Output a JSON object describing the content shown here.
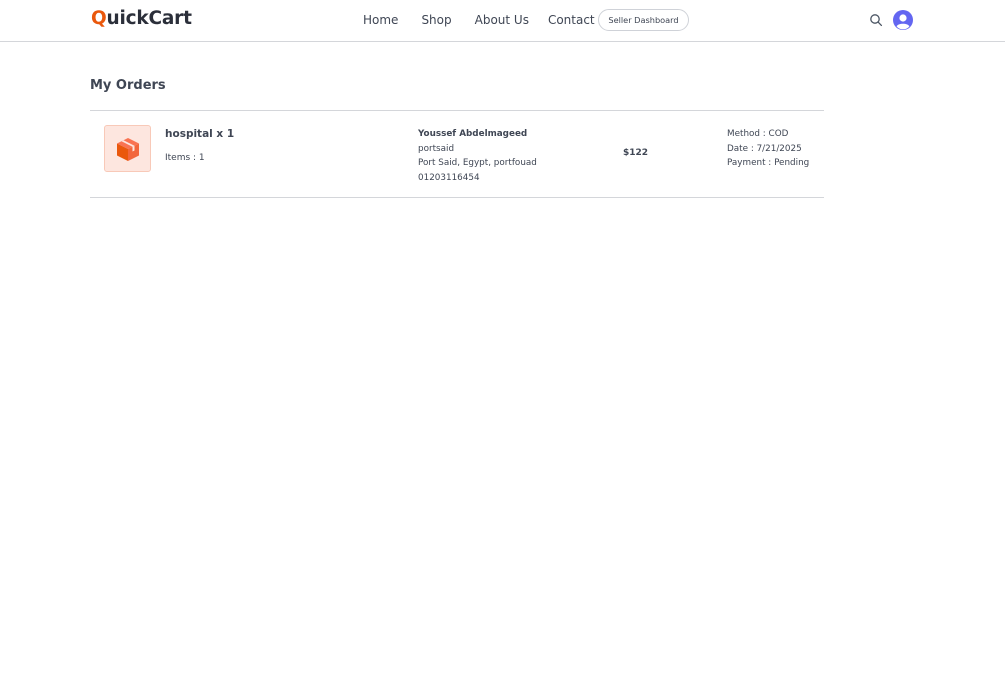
{
  "brand": {
    "logo_first_letter": "Q",
    "logo_rest": "uickCart",
    "accent_color": "#ea580c"
  },
  "nav": {
    "links": [
      {
        "label": "Home"
      },
      {
        "label": "Shop"
      },
      {
        "label": "About Us"
      },
      {
        "label": "Contact"
      }
    ],
    "seller_button_label": "Seller Dashboard",
    "search_icon": "search-icon",
    "avatar_icon": "user-avatar-icon",
    "avatar_color": "#6366f1"
  },
  "page": {
    "title": "My Orders"
  },
  "orders": [
    {
      "icon": "box-icon",
      "product_summary": "hospital x 1",
      "items_label": "Items : 1",
      "customer_name": "Youssef Abdelmageed",
      "address_line1": "portsaid",
      "address_line2": "Port Said, Egypt, portfouad",
      "phone": "01203116454",
      "amount": "$122",
      "method": "Method : COD",
      "date": "Date : 7/21/2025",
      "payment": "Payment : Pending"
    }
  ]
}
